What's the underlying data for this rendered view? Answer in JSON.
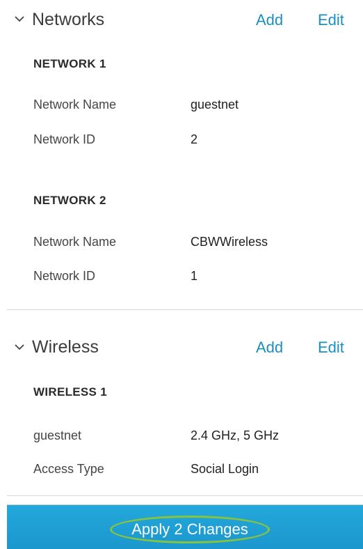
{
  "networks": {
    "title": "Networks",
    "add_label": "Add",
    "edit_label": "Edit",
    "groups": [
      {
        "title": "NETWORK 1",
        "rows": [
          {
            "label": "Network Name",
            "value": "guestnet"
          },
          {
            "label": "Network ID",
            "value": "2"
          }
        ]
      },
      {
        "title": "NETWORK 2",
        "rows": [
          {
            "label": "Network Name",
            "value": "CBWWireless"
          },
          {
            "label": "Network ID",
            "value": "1"
          }
        ]
      }
    ]
  },
  "wireless": {
    "title": "Wireless",
    "add_label": "Add",
    "edit_label": "Edit",
    "groups": [
      {
        "title": "WIRELESS 1",
        "rows": [
          {
            "label": "guestnet",
            "value": "2.4 GHz, 5 GHz"
          },
          {
            "label": "Access Type",
            "value": "Social Login"
          }
        ]
      }
    ]
  },
  "apply": {
    "label": "Apply 2 Changes"
  },
  "colors": {
    "accent_link": "#1b8fbf",
    "apply_bar": "#1b97cd",
    "highlight_oval": "#86c340"
  },
  "icons": {
    "collapse": "chevron-down-icon"
  }
}
